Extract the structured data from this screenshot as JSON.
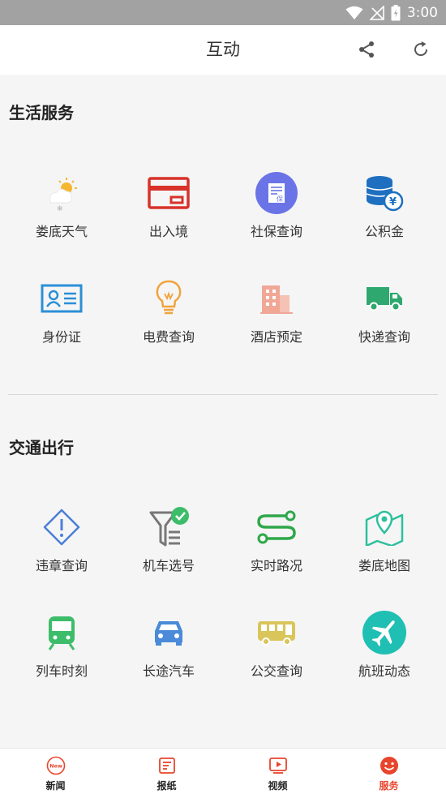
{
  "status_bar": {
    "time": "3:00"
  },
  "app_bar": {
    "title": "互动",
    "share_icon": "share-icon",
    "refresh_icon": "refresh-icon"
  },
  "sections": [
    {
      "title": "生活服务",
      "items": [
        {
          "label": "娄底天气",
          "icon": "weather-icon"
        },
        {
          "label": "出入境",
          "icon": "passport-card-icon"
        },
        {
          "label": "社保查询",
          "icon": "social-security-icon"
        },
        {
          "label": "公积金",
          "icon": "coins-yuan-icon"
        },
        {
          "label": "身份证",
          "icon": "id-card-icon"
        },
        {
          "label": "电费查询",
          "icon": "lightbulb-icon"
        },
        {
          "label": "酒店预定",
          "icon": "hotel-building-icon"
        },
        {
          "label": "快递查询",
          "icon": "delivery-truck-icon"
        }
      ]
    },
    {
      "title": "交通出行",
      "items": [
        {
          "label": "违章查询",
          "icon": "warning-diamond-icon"
        },
        {
          "label": "机车选号",
          "icon": "funnel-check-icon"
        },
        {
          "label": "实时路况",
          "icon": "route-icon"
        },
        {
          "label": "娄底地图",
          "icon": "map-pin-icon"
        },
        {
          "label": "列车时刻",
          "icon": "train-icon"
        },
        {
          "label": "长途汽车",
          "icon": "car-icon"
        },
        {
          "label": "公交查询",
          "icon": "bus-icon"
        },
        {
          "label": "航班动态",
          "icon": "airplane-icon"
        }
      ]
    }
  ],
  "bottom_nav": [
    {
      "label": "新闻",
      "icon": "news-icon",
      "active": false
    },
    {
      "label": "报纸",
      "icon": "newspaper-icon",
      "active": false
    },
    {
      "label": "视频",
      "icon": "video-icon",
      "active": false
    },
    {
      "label": "服务",
      "icon": "smiley-icon",
      "active": true
    }
  ],
  "colors": {
    "accent": "#e8452c",
    "status_bar": "#a2a2a2",
    "background": "#f5f5f5"
  }
}
